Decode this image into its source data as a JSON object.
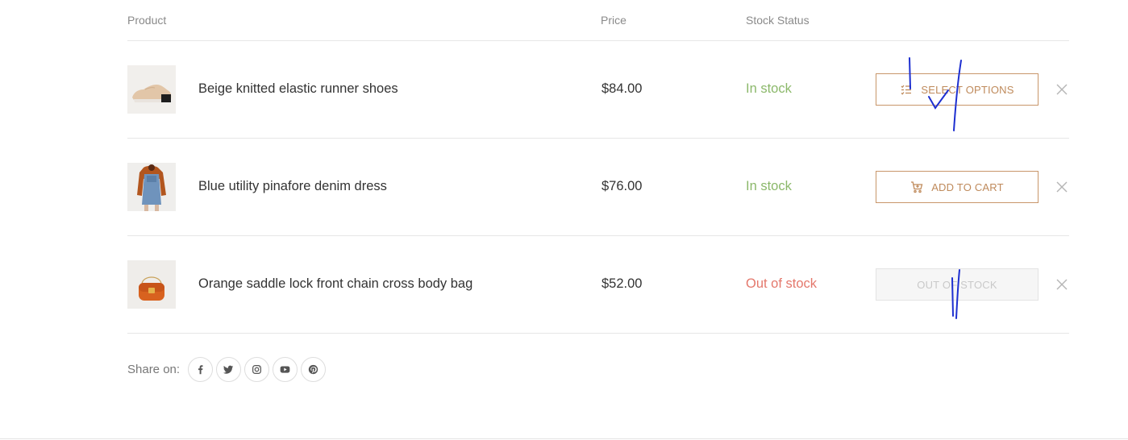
{
  "table": {
    "headers": {
      "product": "Product",
      "price": "Price",
      "stock": "Stock Status"
    },
    "rows": [
      {
        "name": "Beige knitted elastic runner shoes",
        "price": "$84.00",
        "stock": "In stock",
        "action": "SELECT OPTIONS",
        "action_icon": "list-icon",
        "image": "beige-shoe-thumbnail"
      },
      {
        "name": "Blue utility pinafore denim dress",
        "price": "$76.00",
        "stock": "In stock",
        "action": "ADD TO CART",
        "action_icon": "cart-icon",
        "image": "denim-dress-thumbnail"
      },
      {
        "name": "Orange saddle lock front chain cross body bag",
        "price": "$52.00",
        "stock": "Out of stock",
        "action": "OUT OF STOCK",
        "action_icon": "",
        "image": "orange-bag-thumbnail"
      }
    ]
  },
  "share": {
    "label": "Share on:",
    "networks": [
      "facebook-icon",
      "twitter-icon",
      "instagram-icon",
      "youtube-icon",
      "pinterest-icon"
    ]
  },
  "colors": {
    "accent": "#bf8a5b",
    "in_stock": "#8bb86a",
    "out_of_stock": "#e4786c",
    "scribble": "#1d2fd0"
  }
}
